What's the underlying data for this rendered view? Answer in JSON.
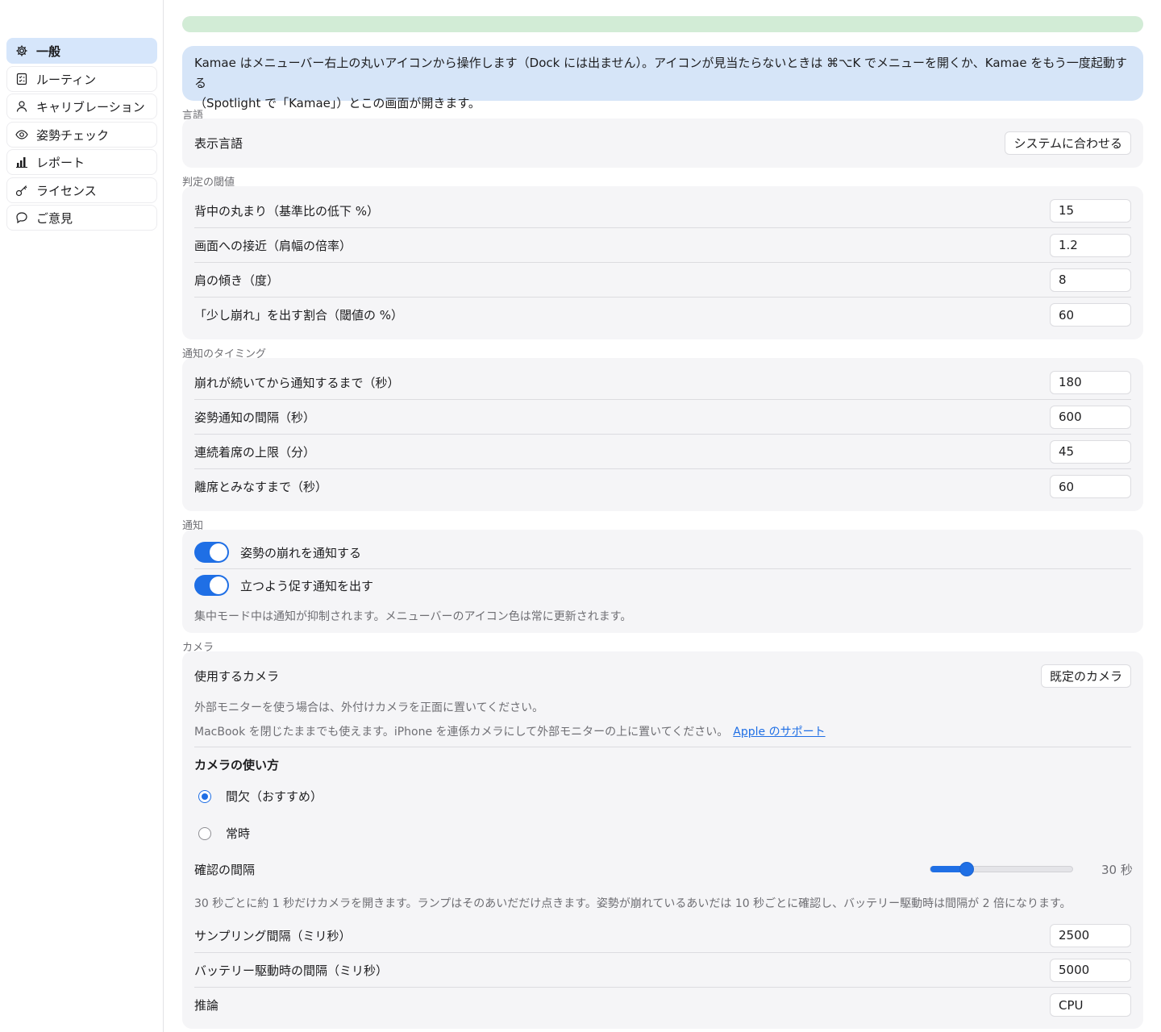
{
  "sidebar": {
    "items": [
      {
        "label": "一般",
        "icon": "gear-icon"
      },
      {
        "label": "ルーティン",
        "icon": "checklist-icon"
      },
      {
        "label": "キャリブレーション",
        "icon": "person-icon"
      },
      {
        "label": "姿勢チェック",
        "icon": "eye-icon"
      },
      {
        "label": "レポート",
        "icon": "chart-icon"
      },
      {
        "label": "ライセンス",
        "icon": "key-icon"
      },
      {
        "label": "ご意見",
        "icon": "speech-bubble-icon"
      }
    ]
  },
  "progress": {
    "value": 1.0,
    "color": "#d2ecd6"
  },
  "banner": {
    "line1": "Kamae はメニューバー右上の丸いアイコンから操作します（Dock には出ません）。アイコンが見当たらないときは ⌘⌥K でメニューを開くか、Kamae をもう一度起動する",
    "line2": "（Spotlight で「Kamae」）とこの画面が開きます。"
  },
  "language": {
    "section": "言語",
    "label": "表示言語",
    "value": "システムに合わせる"
  },
  "thresholds": {
    "section": "判定の閾値",
    "rows": [
      {
        "label": "背中の丸まり（基準比の低下 %）",
        "value": "15"
      },
      {
        "label": "画面への接近（肩幅の倍率）",
        "value": "1.2"
      },
      {
        "label": "肩の傾き（度）",
        "value": "8"
      },
      {
        "label": "「少し崩れ」を出す割合（閾値の %）",
        "value": "60"
      }
    ]
  },
  "timing": {
    "section": "通知のタイミング",
    "rows": [
      {
        "label": "崩れが続いてから通知するまで（秒）",
        "value": "180"
      },
      {
        "label": "姿勢通知の間隔（秒）",
        "value": "600"
      },
      {
        "label": "連続着席の上限（分）",
        "value": "45"
      },
      {
        "label": "離席とみなすまで（秒）",
        "value": "60"
      }
    ]
  },
  "notifications": {
    "section": "通知",
    "toggles": [
      {
        "label": "姿勢の崩れを通知する",
        "on": true
      },
      {
        "label": "立つよう促す通知を出す",
        "on": true
      }
    ],
    "note": "集中モード中は通知が抑制されます。メニューバーのアイコン色は常に更新されます。"
  },
  "camera": {
    "section": "カメラ",
    "label": "使用するカメラ",
    "value": "既定のカメラ",
    "note1": "外部モニターを使う場合は、外付けカメラを正面に置いてください。",
    "note2": "MacBook を閉じたままでも使えます。iPhone を連係カメラにして外部モニターの上に置いてください。",
    "link": "Apple のサポート",
    "usage_heading": "カメラの使い方",
    "options": [
      {
        "label": "間欠（おすすめ）",
        "selected": true
      },
      {
        "label": "常時",
        "selected": false
      }
    ],
    "interval_label": "確認の間隔",
    "interval_value": "30 秒",
    "interval_level": 0.25,
    "interval_note": "30 秒ごとに約 1 秒だけカメラを開きます。ランプはそのあいだだけ点きます。姿勢が崩れているあいだは 10 秒ごとに確認し、バッテリー駆動時は間隔が 2 倍になります。",
    "rows": [
      {
        "label": "サンプリング間隔（ミリ秒）",
        "value": "2500"
      },
      {
        "label": "バッテリー駆動時の間隔（ミリ秒）",
        "value": "5000"
      },
      {
        "label": "推論",
        "value": "CPU"
      }
    ]
  },
  "colors": {
    "accent": "#1f6fe5",
    "banner": "#d6e5f8",
    "card": "#f5f5f7",
    "active_nav": "#d6e6fb"
  }
}
